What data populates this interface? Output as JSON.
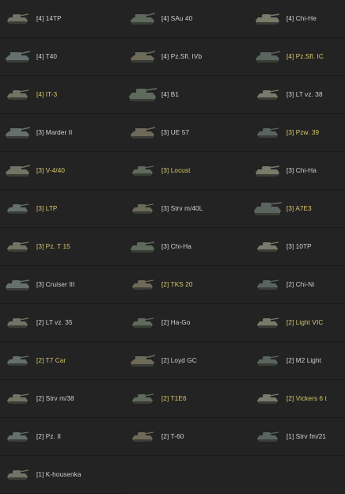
{
  "tank_list": {
    "accent_color": "#d7c96a",
    "text_color": "#d2d2d2",
    "items": [
      {
        "label": "[4] 14TP",
        "highlight": false,
        "icon": "light-tank-icon"
      },
      {
        "label": "[4] SAu 40",
        "highlight": false,
        "icon": "tank-destroyer-icon"
      },
      {
        "label": "[4] Chi-He",
        "highlight": false,
        "icon": "medium-tank-icon"
      },
      {
        "label": "[4] T40",
        "highlight": false,
        "icon": "tank-destroyer-icon"
      },
      {
        "label": "[4] Pz.Sfl. IVb",
        "highlight": false,
        "icon": "tank-destroyer-icon"
      },
      {
        "label": "[4] Pz.Sfl. IC",
        "highlight": true,
        "icon": "tank-destroyer-icon"
      },
      {
        "label": "[4] IT-3",
        "highlight": true,
        "icon": "light-tank-icon"
      },
      {
        "label": "[4] B1",
        "highlight": false,
        "icon": "heavy-tank-icon"
      },
      {
        "label": "[3] LT vz. 38",
        "highlight": false,
        "icon": "light-tank-icon"
      },
      {
        "label": "[3] Marder II",
        "highlight": false,
        "icon": "tank-destroyer-icon"
      },
      {
        "label": "[3] UE 57",
        "highlight": false,
        "icon": "tank-destroyer-icon"
      },
      {
        "label": "[3] Pzw. 39",
        "highlight": true,
        "icon": "light-tank-icon"
      },
      {
        "label": "[3] V-4/40",
        "highlight": true,
        "icon": "tank-destroyer-icon"
      },
      {
        "label": "[3] Locust",
        "highlight": true,
        "icon": "light-tank-icon"
      },
      {
        "label": "[3] Chi-Ha",
        "highlight": false,
        "icon": "medium-tank-icon"
      },
      {
        "label": "[3] LTP",
        "highlight": true,
        "icon": "light-tank-icon"
      },
      {
        "label": "[3] Strv m/40L",
        "highlight": false,
        "icon": "light-tank-icon"
      },
      {
        "label": "[3] A7E3",
        "highlight": true,
        "icon": "heavy-tank-icon"
      },
      {
        "label": "[3] Pz. T 15",
        "highlight": true,
        "icon": "light-tank-icon"
      },
      {
        "label": "[3] Chi-Ha",
        "highlight": false,
        "icon": "medium-tank-icon"
      },
      {
        "label": "[3] 10TP",
        "highlight": false,
        "icon": "light-tank-icon"
      },
      {
        "label": "[3] Cruiser III",
        "highlight": false,
        "icon": "medium-tank-icon"
      },
      {
        "label": "[2] TKS 20",
        "highlight": true,
        "icon": "light-tank-icon"
      },
      {
        "label": "[2] Chi-Ni",
        "highlight": false,
        "icon": "light-tank-icon"
      },
      {
        "label": "[2] LT vz. 35",
        "highlight": false,
        "icon": "light-tank-icon"
      },
      {
        "label": "[2] Ha-Go",
        "highlight": false,
        "icon": "light-tank-icon"
      },
      {
        "label": "[2] Light VIC",
        "highlight": true,
        "icon": "light-tank-icon"
      },
      {
        "label": "[2] T7 Car",
        "highlight": true,
        "icon": "light-tank-icon"
      },
      {
        "label": "[2] Loyd GC",
        "highlight": false,
        "icon": "tank-destroyer-icon"
      },
      {
        "label": "[2] M2 Light",
        "highlight": false,
        "icon": "light-tank-icon"
      },
      {
        "label": "[2] Strv m/38",
        "highlight": false,
        "icon": "light-tank-icon"
      },
      {
        "label": "[2] T1E6",
        "highlight": true,
        "icon": "light-tank-icon"
      },
      {
        "label": "[2] Vickers 6 t",
        "highlight": true,
        "icon": "light-tank-icon"
      },
      {
        "label": "[2] Pz. II",
        "highlight": false,
        "icon": "light-tank-icon"
      },
      {
        "label": "[2] T-60",
        "highlight": false,
        "icon": "light-tank-icon"
      },
      {
        "label": "[1] Strv fm/21",
        "highlight": false,
        "icon": "light-tank-icon"
      },
      {
        "label": "[1] K-housenka",
        "highlight": false,
        "icon": "light-tank-icon"
      }
    ]
  }
}
